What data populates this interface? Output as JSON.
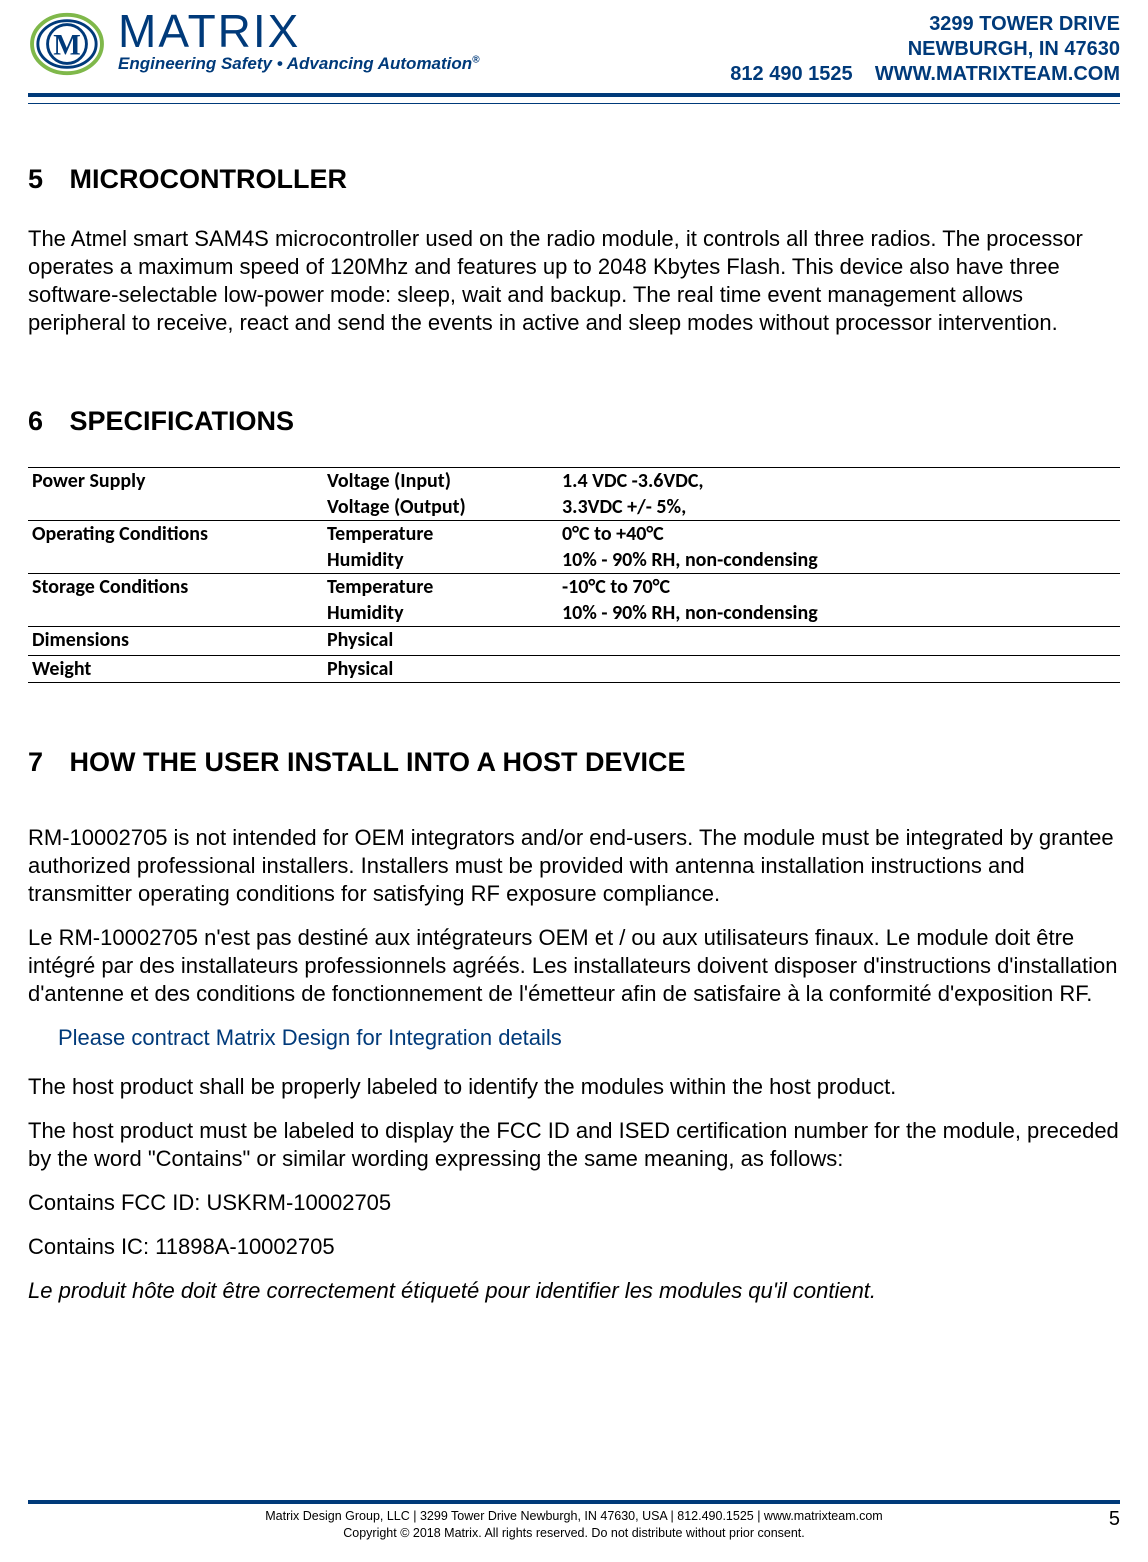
{
  "header": {
    "brand_name": "MATRIX",
    "brand_tag_html": "Engineering Safety • Advancing Automation",
    "addr1": "3299 TOWER DRIVE",
    "addr2": "NEWBURGH, IN 47630",
    "phone": "812 490 1525",
    "site": "WWW.MATRIXTEAM.COM"
  },
  "sections": {
    "s5": {
      "num": "5",
      "title": "MICROCONTROLLER",
      "para1": "The Atmel smart SAM4S microcontroller used on the radio module, it controls all three radios.  The processor operates a maximum speed of 120Mhz and features up to 2048 Kbytes Flash. This device also have three software-selectable low-power mode: sleep, wait and backup.  The real time event management allows peripheral to receive, react and send the events in active and sleep modes without processor intervention."
    },
    "s6": {
      "num": "6",
      "title": "SPECIFICATIONS",
      "rows": [
        {
          "divider": true,
          "c1": "Power Supply",
          "c2": "Voltage (Input)",
          "c3": "1.4 VDC -3.6VDC,"
        },
        {
          "divider": false,
          "c1": "",
          "c2": "Voltage (Output)",
          "c3": "3.3VDC +/- 5%,"
        },
        {
          "divider": true,
          "c1": "Operating Conditions",
          "c2": "Temperature",
          "c3": "0°C to +40°C"
        },
        {
          "divider": false,
          "c1": "",
          "c2": "Humidity",
          "c3": "10% - 90% RH, non-condensing"
        },
        {
          "divider": true,
          "c1": "Storage Conditions",
          "c2": "Temperature",
          "c3": "-10°C to 70°C"
        },
        {
          "divider": false,
          "c1": "",
          "c2": "Humidity",
          "c3": "10% - 90% RH, non-condensing"
        },
        {
          "divider": true,
          "c1": "Dimensions",
          "c2": "Physical",
          "c3": ""
        },
        {
          "divider": false,
          "c1": "",
          "c2": "",
          "c3": ""
        },
        {
          "divider": true,
          "c1": "Weight",
          "c2": "Physical",
          "c3": ""
        },
        {
          "divider": true,
          "c1": "",
          "c2": "",
          "c3": ""
        }
      ]
    },
    "s7": {
      "num": "7",
      "title": "HOW THE USER INSTALL INTO A HOST DEVICE",
      "para1": "RM-10002705 is not intended for OEM integrators and/or end-users. The module must be integrated by grantee authorized professional installers. Installers must be provided with antenna installation instructions and transmitter operating conditions for satisfying RF exposure compliance.",
      "para2": "Le RM-10002705 n'est pas destiné aux intégrateurs OEM et / ou aux utilisateurs finaux. Le module doit être intégré par des installateurs professionnels agréés. Les installateurs doivent disposer d'instructions d'installation d'antenne et des conditions de fonctionnement de l'émetteur afin de satisfaire à la conformité d'exposition RF.",
      "contact_note": "Please contract Matrix Design for Integration details",
      "para3": "The host product shall be properly labeled to identify the modules within the host product.",
      "para4": "The host product must be labeled to display the FCC ID and ISED certification number for the module, preceded by the word \"Contains\" or similar wording expressing the same meaning, as follows:",
      "para5": "Contains FCC ID: USKRM-10002705",
      "para6": "Contains IC: 11898A-10002705",
      "para7": "Le produit hôte doit être correctement étiqueté pour identifier les modules qu'il contient."
    }
  },
  "footer": {
    "line1": "Matrix Design Group, LLC | 3299 Tower Drive Newburgh, IN 47630, USA | 812.490.1525 | www.matrixteam.com",
    "line2": "Copyright © 2018 Matrix. All rights reserved. Do not distribute without prior consent.",
    "page": "5"
  }
}
